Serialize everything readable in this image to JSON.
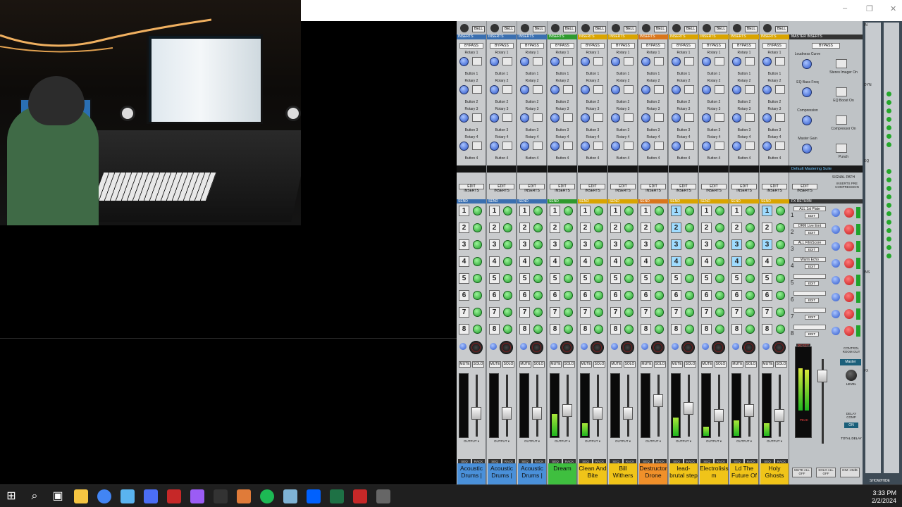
{
  "window": {
    "controls": {
      "minimize": "–",
      "restore": "❐",
      "close": "✕"
    }
  },
  "channels": [
    {
      "name": "Acoustic Drums |",
      "color": "#4a90d9",
      "send_color": "#3a6fb0",
      "insert_color": "#3a6fb0",
      "meter": 0.0,
      "fader": 0.35,
      "sends_on": []
    },
    {
      "name": "Acoustic Drums |",
      "color": "#4a90d9",
      "send_color": "#3a6fb0",
      "insert_color": "#3a6fb0",
      "meter": 0.0,
      "fader": 0.35,
      "sends_on": []
    },
    {
      "name": "Acoustic Drums |",
      "color": "#4a90d9",
      "send_color": "#3a6fb0",
      "insert_color": "#3a6fb0",
      "meter": 0.0,
      "fader": 0.35,
      "sends_on": []
    },
    {
      "name": "Dream",
      "color": "#3fbf3f",
      "send_color": "#2e9a2e",
      "insert_color": "#2e9a2e",
      "meter": 0.35,
      "fader": 0.4,
      "sends_on": []
    },
    {
      "name": "Clean And Bite",
      "color": "#f0c419",
      "send_color": "#d9a400",
      "insert_color": "#d9a400",
      "meter": 0.2,
      "fader": 0.35,
      "sends_on": []
    },
    {
      "name": "Bill Withers",
      "color": "#f0c419",
      "send_color": "#d9a400",
      "insert_color": "#d9a400",
      "meter": 0.0,
      "fader": 0.35,
      "sends_on": []
    },
    {
      "name": "Destructor Drone",
      "color": "#f0902a",
      "send_color": "#d9761a",
      "insert_color": "#d9761a",
      "meter": 0.0,
      "fader": 0.6,
      "sends_on": []
    },
    {
      "name": "lead-brutal step",
      "color": "#f0c419",
      "send_color": "#d9a400",
      "insert_color": "#d9a400",
      "meter": 0.3,
      "fader": 0.45,
      "sends_on": [
        1,
        2,
        3,
        4
      ]
    },
    {
      "name": "Electrolisis m",
      "color": "#f0c419",
      "send_color": "#d9a400",
      "insert_color": "#d9a400",
      "meter": 0.15,
      "fader": 0.3,
      "sends_on": []
    },
    {
      "name": "Ld The Future Of",
      "color": "#f0c419",
      "send_color": "#d9a400",
      "insert_color": "#d9a400",
      "meter": 0.25,
      "fader": 0.4,
      "sends_on": [
        3,
        4
      ]
    },
    {
      "name": "Holy Ghosts",
      "color": "#f0c419",
      "send_color": "#d9a400",
      "insert_color": "#d9a400",
      "meter": 0.2,
      "fader": 0.3,
      "sends_on": [
        1,
        3
      ]
    }
  ],
  "strip_labels": {
    "bell": "BELL",
    "inserts": "INSERTS",
    "bypass": "BYPASS",
    "rotary": [
      "Rotary 1",
      "Rotary 2",
      "Rotary 3",
      "Rotary 4"
    ],
    "button": [
      "Button 1",
      "Button 2",
      "Button 3",
      "Button 4"
    ],
    "edit_inserts": "EDIT INSERTS",
    "send": "SEND",
    "width": "WIDTH",
    "mute": "MUTE",
    "solo": "SOLO",
    "output": "OUTPUT ▾",
    "seq": "SEQ",
    "rack": "RACK",
    "send_numbers": [
      "1",
      "2",
      "3",
      "4",
      "5",
      "6",
      "7",
      "8"
    ]
  },
  "master": {
    "inserts_label": "MASTER INSERTS",
    "bypass": "BYPASS",
    "knobs": [
      {
        "label": "Loudness Curve",
        "button": "Stereo Imager On"
      },
      {
        "label": "EQ Bass Freq",
        "button": "EQ Boost On"
      },
      {
        "label": "Compression",
        "button": "Compressor On"
      },
      {
        "label": "Master Gain",
        "button": "Punch"
      }
    ],
    "suite": "Default Mastering Suite",
    "signal_path": "SIGNAL PATH",
    "inserts_pre": "INSERTS PRE COMPRESSION",
    "edit_inserts": "EDIT INSERTS",
    "fx_return": "FX RETURN",
    "fx": [
      {
        "num": "1",
        "name": "ALL 1st Plate"
      },
      {
        "num": "2",
        "name": "DRM Live Emt"
      },
      {
        "num": "3",
        "name": "ALL FilmScore"
      },
      {
        "num": "4",
        "name": "Warm Echo"
      },
      {
        "num": "5",
        "name": ""
      },
      {
        "num": "6",
        "name": ""
      },
      {
        "num": "7",
        "name": ""
      },
      {
        "num": "8",
        "name": ""
      }
    ],
    "edit": "EDIT",
    "reset": "RESET",
    "peak": "PEAK",
    "control_room": "CONTROL ROOM OUT",
    "master_tag": "Master",
    "level": "LEVEL",
    "delay_comp": "DELAY COMP",
    "on": "ON",
    "total_delay": "TOTAL DELAY",
    "mute_all": "MUTE ALL OFF",
    "solo_all": "SOLO ALL OFF",
    "dim": "DIM -20dB"
  },
  "rack": {
    "sections": [
      "IN",
      "DYN",
      "EQ",
      "INS",
      "FX"
    ],
    "show": "SHOW/HIDE"
  },
  "taskbar": {
    "time": "3:33 PM",
    "date": "2/2/2024",
    "icons": [
      "windows-start-icon",
      "search-icon",
      "task-view-icon",
      "file-explorer-icon",
      "chrome-icon",
      "app-icon",
      "vscode-icon",
      "reason-icon",
      "app-icon",
      "waves-icon",
      "app-icon",
      "spotify-icon",
      "app-icon",
      "dropbox-icon",
      "excel-icon",
      "reason-icon",
      "app-icon"
    ]
  }
}
